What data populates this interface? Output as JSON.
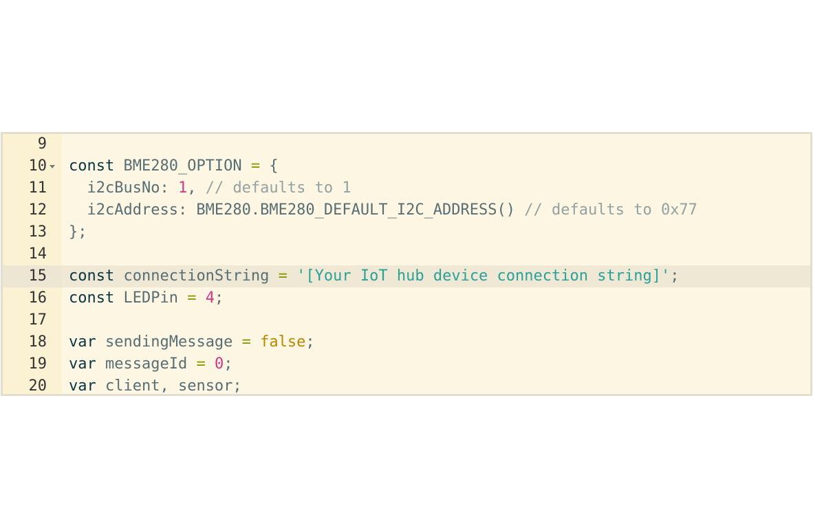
{
  "editor": {
    "lines": [
      {
        "number": "9",
        "tokens": []
      },
      {
        "number": "10",
        "fold": true,
        "tokens": [
          {
            "text": "const",
            "type": "kw"
          },
          {
            "text": " BME280_OPTION ",
            "type": "id"
          },
          {
            "text": "=",
            "type": "op"
          },
          {
            "text": " {",
            "type": "pn"
          }
        ]
      },
      {
        "number": "11",
        "tokens": [
          {
            "text": "  i2cBusNo: ",
            "type": "id"
          },
          {
            "text": "1",
            "type": "num"
          },
          {
            "text": ", ",
            "type": "pn"
          },
          {
            "text": "// defaults to 1",
            "type": "cm"
          }
        ]
      },
      {
        "number": "12",
        "tokens": [
          {
            "text": "  i2cAddress: BME280.BME280_DEFAULT_I2C_ADDRESS() ",
            "type": "id"
          },
          {
            "text": "// defaults to 0x77",
            "type": "cm"
          }
        ]
      },
      {
        "number": "13",
        "tokens": [
          {
            "text": "};",
            "type": "pn"
          }
        ]
      },
      {
        "number": "14",
        "tokens": []
      },
      {
        "number": "15",
        "active": true,
        "tokens": [
          {
            "text": "const",
            "type": "kw"
          },
          {
            "text": " connectionString ",
            "type": "id"
          },
          {
            "text": "=",
            "type": "op"
          },
          {
            "text": " ",
            "type": "pn"
          },
          {
            "text": "'[Your IoT hub device connection string]'",
            "type": "str"
          },
          {
            "text": ";",
            "type": "pn"
          }
        ]
      },
      {
        "number": "16",
        "tokens": [
          {
            "text": "const",
            "type": "kw"
          },
          {
            "text": " LEDPin ",
            "type": "id"
          },
          {
            "text": "=",
            "type": "op"
          },
          {
            "text": " ",
            "type": "pn"
          },
          {
            "text": "4",
            "type": "num"
          },
          {
            "text": ";",
            "type": "pn"
          }
        ]
      },
      {
        "number": "17",
        "tokens": []
      },
      {
        "number": "18",
        "tokens": [
          {
            "text": "var",
            "type": "kw"
          },
          {
            "text": " sendingMessage ",
            "type": "id"
          },
          {
            "text": "=",
            "type": "op"
          },
          {
            "text": " ",
            "type": "pn"
          },
          {
            "text": "false",
            "type": "bool"
          },
          {
            "text": ";",
            "type": "pn"
          }
        ]
      },
      {
        "number": "19",
        "tokens": [
          {
            "text": "var",
            "type": "kw"
          },
          {
            "text": " messageId ",
            "type": "id"
          },
          {
            "text": "=",
            "type": "op"
          },
          {
            "text": " ",
            "type": "pn"
          },
          {
            "text": "0",
            "type": "num"
          },
          {
            "text": ";",
            "type": "pn"
          }
        ]
      },
      {
        "number": "20",
        "tokens": [
          {
            "text": "var",
            "type": "kw"
          },
          {
            "text": " client, sensor;",
            "type": "id"
          }
        ]
      }
    ]
  },
  "colors": {
    "background": "#fdf6e3",
    "gutter": "#fbf1d3",
    "active_line": "#eee8d5",
    "keyword": "#073642",
    "identifier": "#586e75",
    "operator": "#859900",
    "number": "#d33682",
    "string": "#2aa198",
    "boolean": "#b58900",
    "comment": "#93a1a1"
  }
}
